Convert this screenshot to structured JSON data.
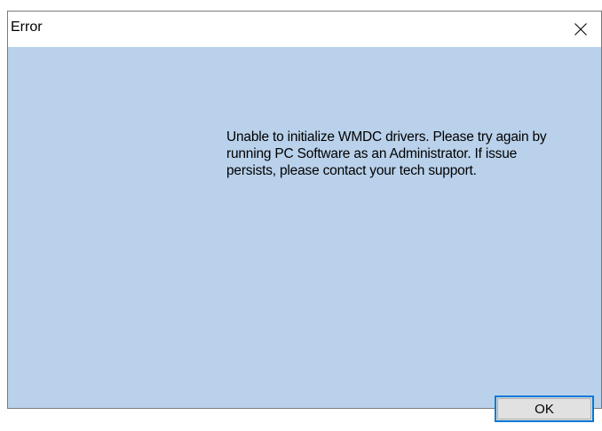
{
  "window": {
    "title": "Error",
    "close_icon": "close-icon"
  },
  "dialog": {
    "message": "Unable to initialize WMDC drivers. Please try again by\nrunning PC Software as an Administrator. If  issue\npersists, please contact your tech support.",
    "ok_label": "OK"
  },
  "colors": {
    "client_background": "#b9d1ea",
    "button_focus_border": "#0078d7",
    "button_face": "#e1e1e1"
  }
}
